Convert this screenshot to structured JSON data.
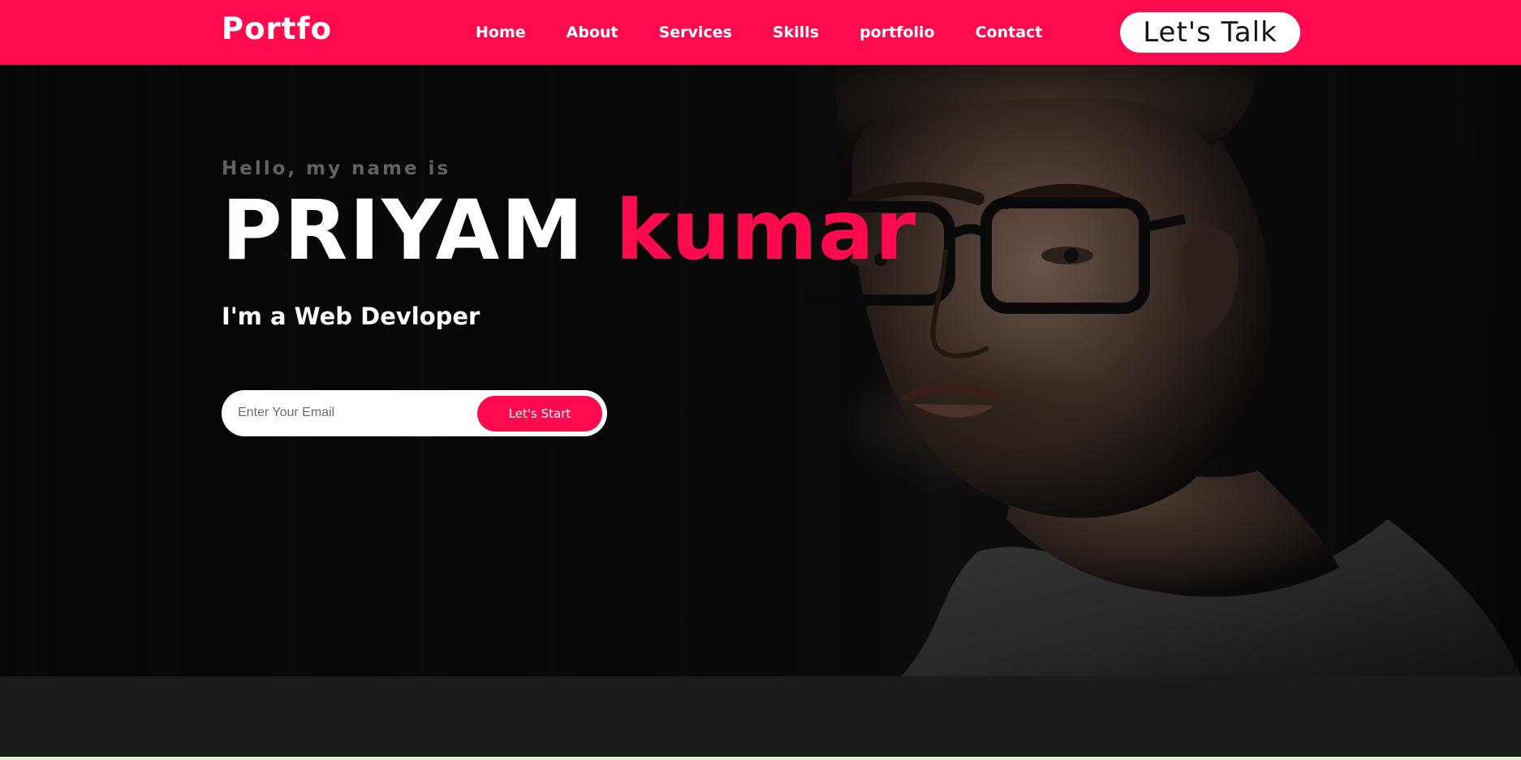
{
  "brand": {
    "logo_text": "Portfo",
    "accent_color": "#ff0a4e",
    "dark_bg": "#1b1b1b"
  },
  "nav": {
    "items": [
      {
        "label": "Home"
      },
      {
        "label": "About"
      },
      {
        "label": "Services"
      },
      {
        "label": "Skills"
      },
      {
        "label": "portfolio"
      },
      {
        "label": "Contact"
      }
    ],
    "cta_label": "Let's Talk"
  },
  "hero": {
    "greeting": "Hello, my name is",
    "first_name": "PRIYAM",
    "last_name": "kumar",
    "role": "I'm a Web Devloper",
    "email_placeholder": "Enter Your Email",
    "email_value": "",
    "start_label": "Let's Start"
  }
}
